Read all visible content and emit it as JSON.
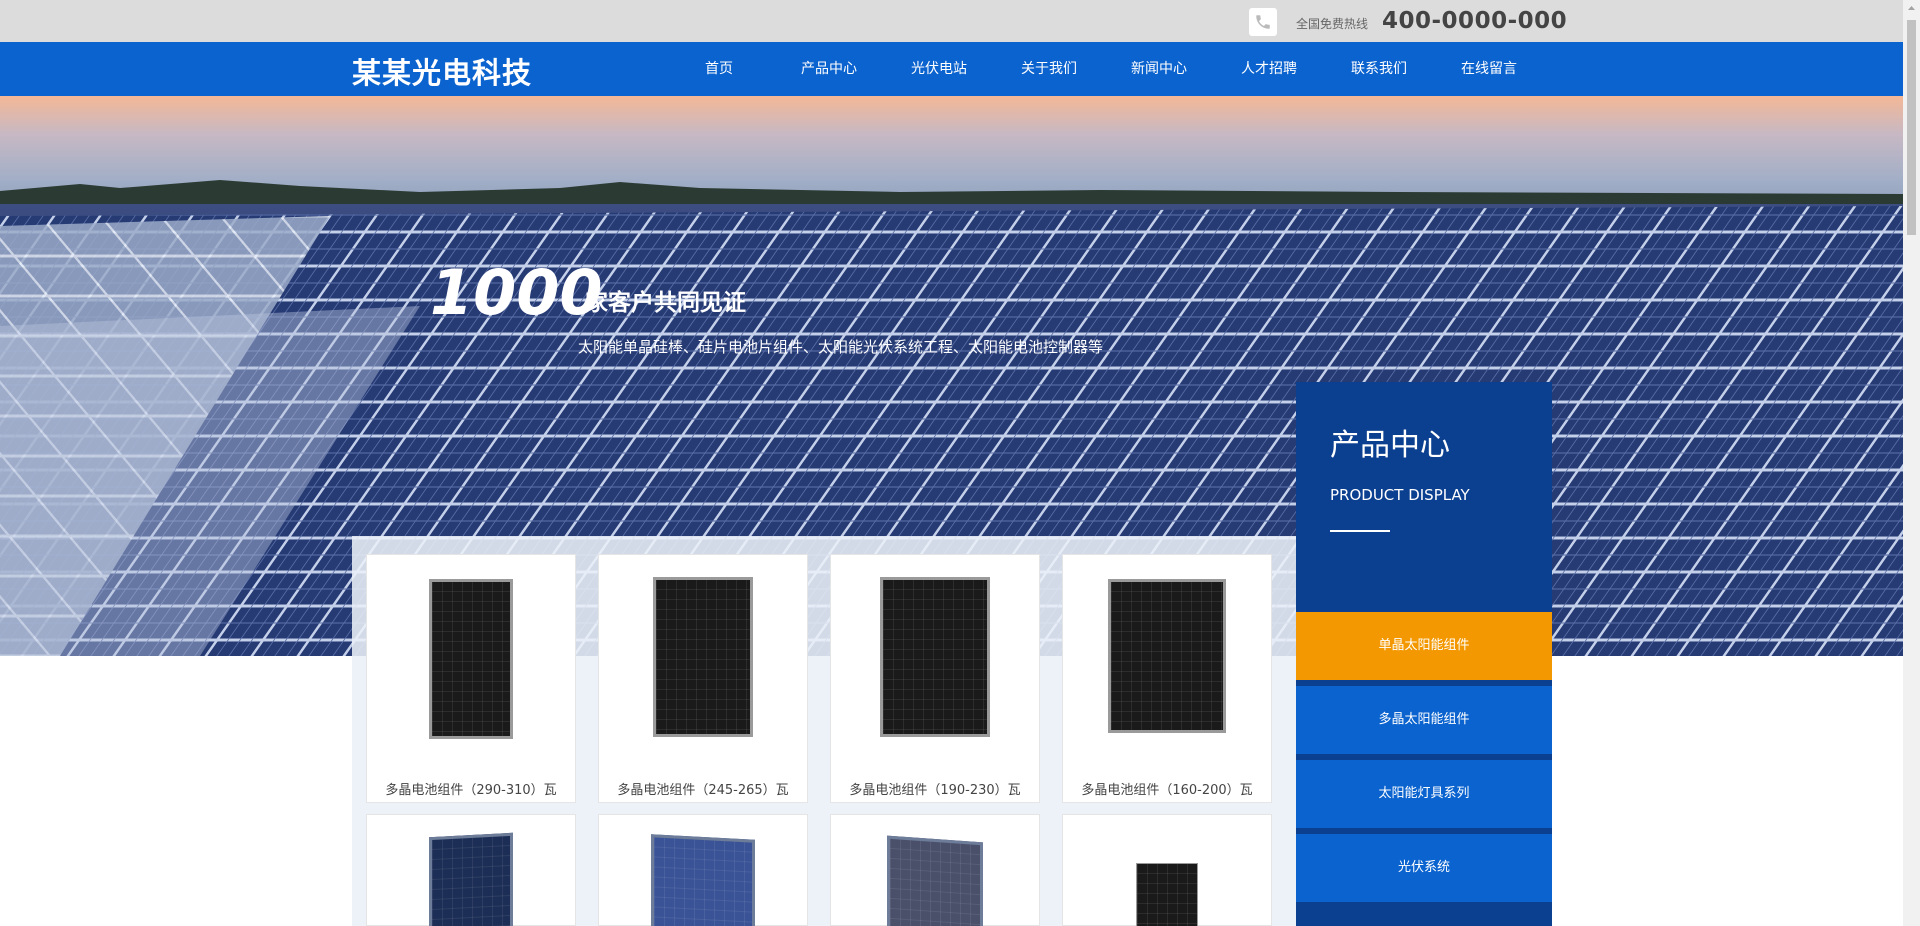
{
  "topbar": {
    "phone_icon": "phone-icon",
    "hotline_label": "全国免费热线",
    "hotline_number": "400-0000-000"
  },
  "header": {
    "logo": "某某光电科技",
    "nav": [
      "首页",
      "产品中心",
      "光伏电站",
      "关于我们",
      "新闻中心",
      "人才招聘",
      "联系我们",
      "在线留言"
    ]
  },
  "banner": {
    "number": "1000",
    "title": "家客户共同见证",
    "subtitle": "太阳能单晶硅棒、硅片电池片组件、太阳能光伏系统工程、太阳能电池控制器等"
  },
  "products": [
    {
      "name": "多晶电池组件（290-310）瓦"
    },
    {
      "name": "多晶电池组件（245-265）瓦"
    },
    {
      "name": "多晶电池组件（190-230）瓦"
    },
    {
      "name": "多晶电池组件（160-200）瓦"
    },
    {
      "name": ""
    },
    {
      "name": ""
    },
    {
      "name": ""
    },
    {
      "name": ""
    }
  ],
  "sidebar": {
    "title": "产品中心",
    "subtitle": "PRODUCT DISPLAY",
    "items": [
      "单晶太阳能组件",
      "多晶太阳能组件",
      "太阳能灯具系列",
      "光伏系统"
    ]
  },
  "colors": {
    "nav_blue": "#0b63cf",
    "side_dark": "#0b3f8f",
    "accent_orange": "#f39800"
  }
}
